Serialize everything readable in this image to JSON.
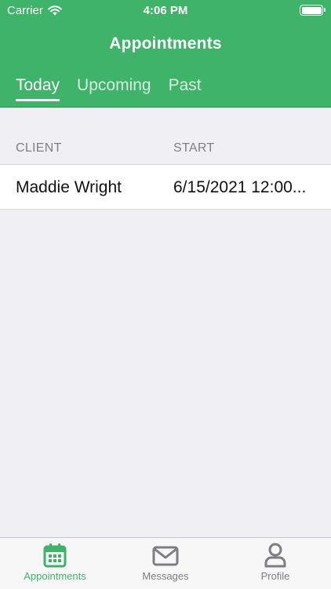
{
  "status_bar": {
    "carrier": "Carrier",
    "time": "4:06 PM"
  },
  "header": {
    "title": "Appointments",
    "tabs": [
      {
        "label": "Today",
        "active": true
      },
      {
        "label": "Upcoming",
        "active": false
      },
      {
        "label": "Past",
        "active": false
      }
    ]
  },
  "table": {
    "columns": [
      "CLIENT",
      "START"
    ],
    "rows": [
      {
        "client": "Maddie Wright",
        "start": "6/15/2021 12:00..."
      }
    ]
  },
  "tabbar": {
    "items": [
      {
        "label": "Appointments",
        "icon": "calendar-icon",
        "active": true
      },
      {
        "label": "Messages",
        "icon": "envelope-icon",
        "active": false
      },
      {
        "label": "Profile",
        "icon": "person-icon",
        "active": false
      }
    ]
  },
  "colors": {
    "brand": "#3fb36a",
    "background": "#efeff4",
    "inactive": "#7d7d83"
  }
}
